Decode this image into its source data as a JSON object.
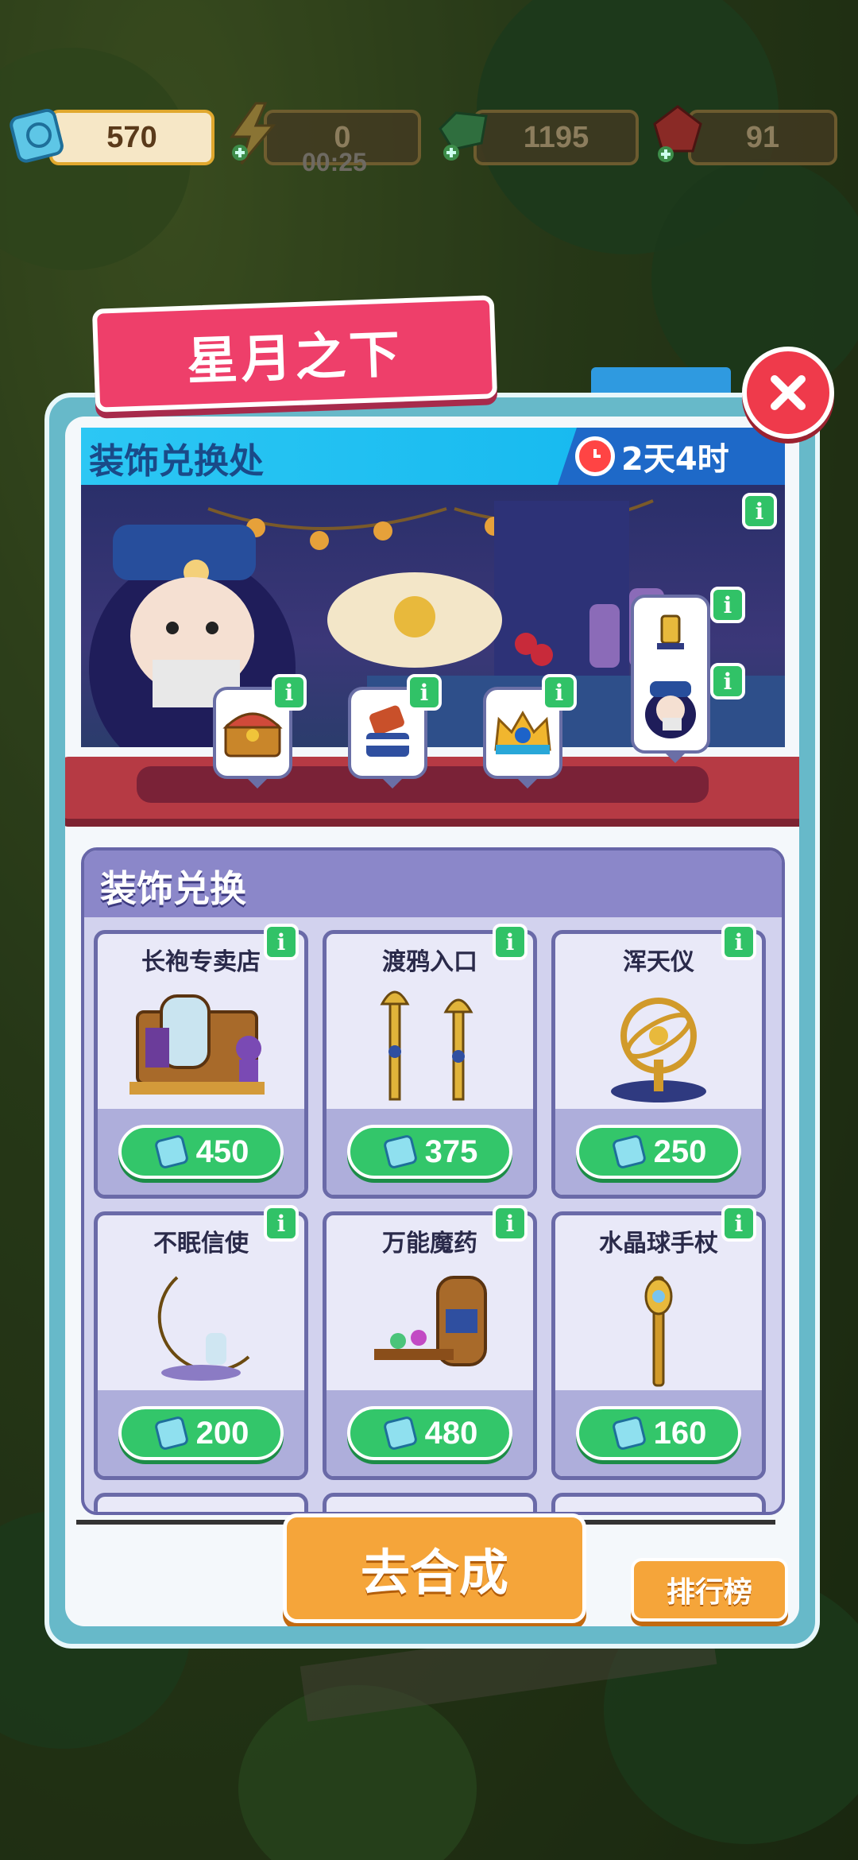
{
  "currencies": {
    "tickets": "570",
    "energy": "0",
    "energy_timer": "00:25",
    "gems": "1195",
    "rubies": "91"
  },
  "event_title": "星月之下",
  "panel": {
    "header_title": "装饰兑换处",
    "time_left": "2天4时",
    "info_glyph": "i"
  },
  "exchange": {
    "section_title": "装饰兑换",
    "items": [
      {
        "name": "长袍专卖店",
        "price": "450",
        "icon": "robe-shop-icon"
      },
      {
        "name": "渡鸦入口",
        "price": "375",
        "icon": "raven-gate-icon"
      },
      {
        "name": "浑天仪",
        "price": "250",
        "icon": "armillary-sphere-icon"
      },
      {
        "name": "不眠信使",
        "price": "200",
        "icon": "moon-messenger-icon"
      },
      {
        "name": "万能魔药",
        "price": "480",
        "icon": "potion-shelf-icon"
      },
      {
        "name": "水晶球手杖",
        "price": "160",
        "icon": "crystal-staff-icon"
      }
    ]
  },
  "buttons": {
    "go_merge": "去合成",
    "leaderboard": "排行榜"
  },
  "colors": {
    "accent_green": "#33c66a",
    "ribbon_pink": "#ee3f6a",
    "header_blue": "#10b5ee",
    "orange_button": "#f5a53a"
  }
}
